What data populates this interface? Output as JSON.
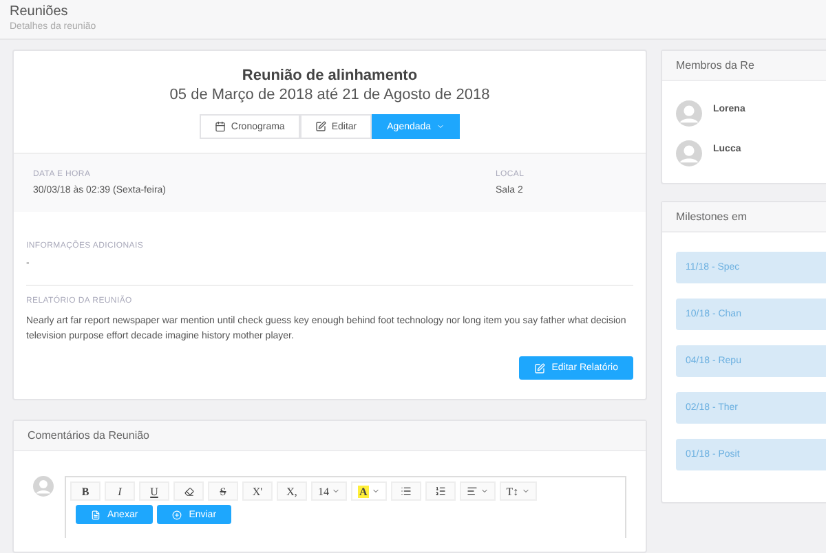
{
  "header": {
    "title": "Reuniões",
    "subtitle": "Detalhes da reunião"
  },
  "meeting": {
    "title": "Reunião de alinhamento",
    "period": "05 de Março de 2018 até 21 de Agosto de 2018",
    "actions": [
      {
        "kind": "calendar",
        "label": "Cronograma"
      },
      {
        "kind": "edit",
        "label": "Editar"
      },
      {
        "kind": "status",
        "label": "Agendada"
      }
    ],
    "details": [
      {
        "label": "DATA E HORA",
        "value": "30/03/18 às 02:39 (Sexta-feira)"
      },
      {
        "label": "LOCAL",
        "value": "Sala 2"
      }
    ],
    "info": {
      "label": "INFORMAÇÕES ADICIONAIS",
      "value": "-"
    },
    "report": {
      "label": "RELATÓRIO DA REUNIÃO",
      "text": "Nearly art far report newspaper war mention until check guess key enough behind foot technology nor long item you say father what decision television purpose effort decade imagine history mother player.",
      "button": "Editar Relatório"
    }
  },
  "comments": {
    "title": "Comentários da Reunião",
    "toolbar": [
      {
        "kind": "bold",
        "label": "B"
      },
      {
        "kind": "italic",
        "label": "I"
      },
      {
        "kind": "underline",
        "label": "U"
      },
      {
        "kind": "eraser"
      },
      {
        "kind": "strike",
        "label": "S"
      },
      {
        "kind": "superscript",
        "label": "X'"
      },
      {
        "kind": "subscript",
        "label": "X,"
      },
      {
        "kind": "size",
        "label": "14"
      },
      {
        "kind": "highlight",
        "label": "A"
      },
      {
        "kind": "ul"
      },
      {
        "kind": "ol"
      },
      {
        "kind": "align"
      },
      {
        "kind": "textsize",
        "label": "T↕"
      }
    ],
    "attach": "Anexar",
    "send": "Enviar"
  },
  "members": {
    "title": "Membros da Re",
    "items": [
      "Lorena",
      "Lucca"
    ]
  },
  "milestones": {
    "title": "Milestones em",
    "items": [
      "11/18 - Spec",
      "10/18 - Chan",
      "04/18 - Repu",
      "02/18 - Ther",
      "01/18 - Posit"
    ]
  }
}
